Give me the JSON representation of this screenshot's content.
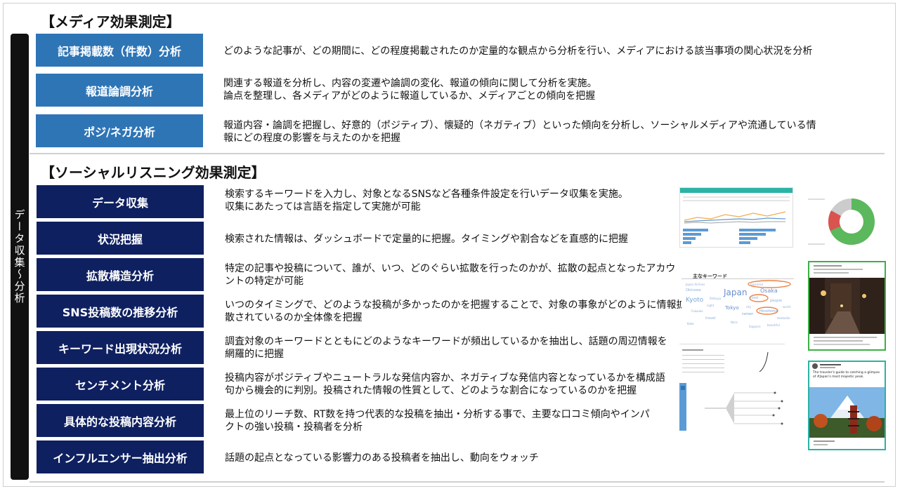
{
  "side_label": "データ収集〜分析",
  "media": {
    "title": "【メディア効果測定】",
    "rows": [
      {
        "label": "記事掲載数（件数）分析",
        "desc1": "どのような記事が、どの期間に、どの程度掲載されたのか定量的な観点から分析を行い、メディアにおける該当事項の関心状況を分析",
        "desc2": ""
      },
      {
        "label": "報道論調分析",
        "desc1": "関連する報道を分析し、内容の変遷や論調の変化、報道の傾向に関して分析を実施。",
        "desc2": "論点を整理し、各メディアがどのように報道しているか、メディアごとの傾向を把握"
      },
      {
        "label": "ポジ/ネガ分析",
        "desc1": "報道内容・論調を把握し、好意的（ポジティブ）、懐疑的（ネガティブ）といった傾向を分析し、ソーシャルメディアや流通している情",
        "desc2": "報にどの程度の影響を与えたのかを把握"
      }
    ]
  },
  "social": {
    "title": "【ソーシャルリスニング効果測定】",
    "rows": [
      {
        "label": "データ収集",
        "desc1": "検索するキーワードを入力し、対象となるSNSなど各種条件設定を行いデータ収集を実施。",
        "desc2": "収集にあたっては言語を指定して実施が可能"
      },
      {
        "label": "状況把握",
        "desc1": "検索された情報は、ダッシュボードで定量的に把握。タイミングや割合などを直感的に把握",
        "desc2": ""
      },
      {
        "label": "拡散構造分析",
        "desc1": "特定の記事や投稿について、誰が、いつ、どのぐらい拡散を行ったのかが、拡散の起点となったアカウ",
        "desc2": "ントの特定が可能"
      },
      {
        "label": "SNS投稿数の推移分析",
        "desc1": "いつのタイミングで、どのような投稿が多かったのかを把握することで、対象の事象がどのように情報拡",
        "desc2": "散されているのか全体像を把握"
      },
      {
        "label": "キーワード出現状況分析",
        "desc1": "調査対象のキーワードとともにどのようなキーワードが頻出しているかを抽出し、話題の周辺情報を",
        "desc2": "網羅的に把握"
      },
      {
        "label": "センチメント分析",
        "desc1": "投稿内容がポジティブやニュートラルな発信内容か、ネガティブな発信内容となっているかを構成語",
        "desc2": "句から機会的に判別。投稿された情報の性質として、どのような割合になっているのかを把握"
      },
      {
        "label": "具体的な投稿内容分析",
        "desc1": "最上位のリーチ数、RT数を持つ代表的な投稿を抽出・分析する事で、主要な口コミ傾向やインパ",
        "desc2": "クトの強い投稿・投稿者を分析"
      },
      {
        "label": "インフルエンサー抽出分析",
        "desc1": "話題の起点となっている影響力のある投稿者を抽出し、動向をウォッチ",
        "desc2": ""
      }
    ]
  },
  "wordcloud": {
    "heading": "主なキーワード",
    "words": [
      "Japan",
      "Osaka",
      "Kyoto",
      "Tokyo",
      "people",
      "Hiroshima",
      "Japanese",
      "Japan Airlines",
      "food",
      "Hokkaido",
      "Okinawa",
      "city",
      "travel",
      "ramen",
      "night",
      "Fukuoka",
      "Nara",
      "Shibuya",
      "beautiful",
      "Kobe",
      "Sapporo",
      "world"
    ]
  },
  "tweet": {
    "text": "The traveler's guide to catching a glimpse of #Japan's most majestic peak."
  },
  "colors": {
    "media_box": "#2e75b6",
    "social_box": "#0e2060",
    "side_bar": "#111111",
    "divider": "#d0d0d0",
    "thumb_border_green": "#3cb043",
    "thumb_border_teal": "#2bb3a6",
    "pie_green": "#5cb85c",
    "pie_red": "#d9534f",
    "pie_gray": "#cccccc"
  }
}
